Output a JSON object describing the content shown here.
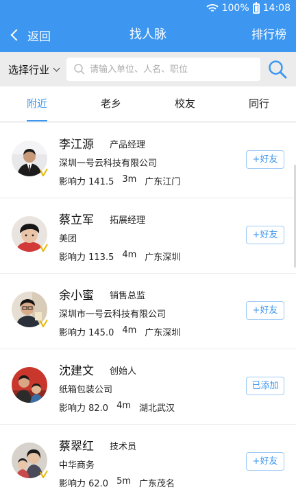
{
  "status": {
    "battery": "100%",
    "time": "14:08"
  },
  "nav": {
    "back_label": "返回",
    "title": "找人脉",
    "rank_label": "排行榜"
  },
  "search": {
    "industry_label": "选择行业",
    "placeholder": "请输入单位、人名、职位"
  },
  "tabs": [
    {
      "label": "附近",
      "active": true
    },
    {
      "label": "老乡",
      "active": false
    },
    {
      "label": "校友",
      "active": false
    },
    {
      "label": "同行",
      "active": false
    }
  ],
  "people": [
    {
      "name": "李江源",
      "title": "产品经理",
      "company": "深圳一号云科技有限公司",
      "influence": "影响力 141.5",
      "distance": "3m",
      "location": "广东江门",
      "button": "+好友"
    },
    {
      "name": "蔡立军",
      "title": "拓展经理",
      "company": "美团",
      "influence": "影响力 113.5",
      "distance": "4m",
      "location": "广东深圳",
      "button": "+好友"
    },
    {
      "name": "余小蜜",
      "title": "销售总监",
      "company": "深圳市一号云科技有限公司",
      "influence": "影响力 145.0",
      "distance": "4m",
      "location": "广东深圳",
      "button": "+好友"
    },
    {
      "name": "沈建文",
      "title": "创始人",
      "company": "纸箱包装公司",
      "influence": "影响力 82.0",
      "distance": "4m",
      "location": "湖北武汉",
      "button": "已添加"
    },
    {
      "name": "蔡翠红",
      "title": "技术员",
      "company": "中华商务",
      "influence": "影响力 62.0",
      "distance": "5m",
      "location": "广东茂名",
      "button": "+好友"
    }
  ],
  "colors": {
    "primary": "#3d97f0",
    "badge": "#e8b600"
  }
}
